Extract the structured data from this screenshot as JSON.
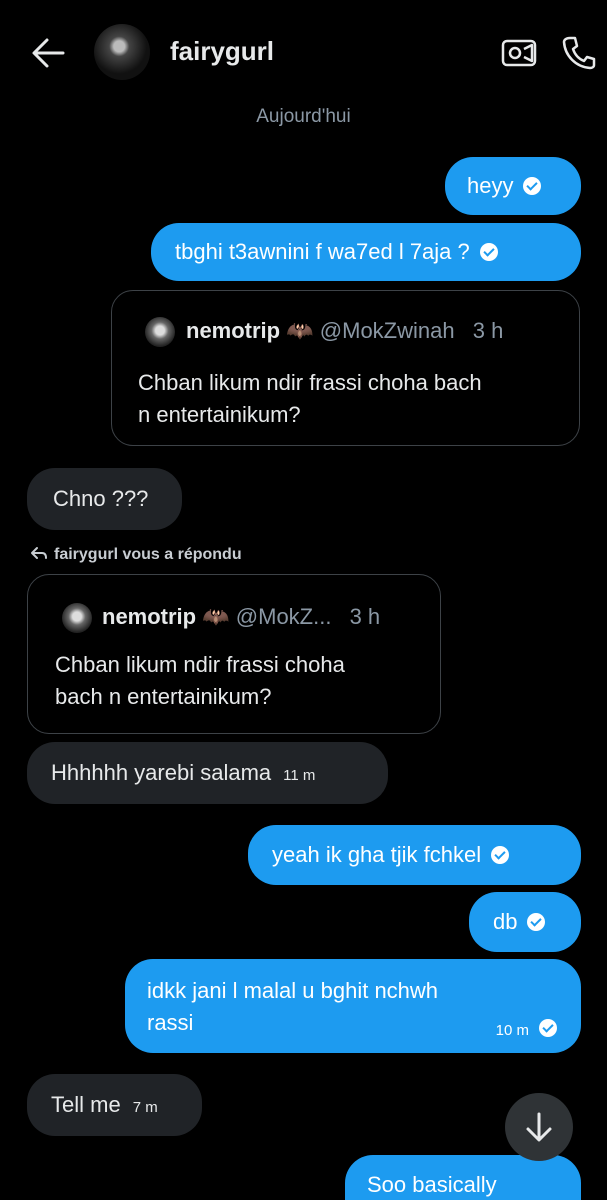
{
  "header": {
    "title": "fairygurl"
  },
  "day_label": "Aujourd'hui",
  "messages": {
    "m1": "heyy",
    "m2": "tbghi t3awnini f wa7ed l 7aja ?",
    "quote1": {
      "name": "nemotrip",
      "emoji": "🦇",
      "handle": "@MokZwinah",
      "time": "3 h",
      "line1": "Chban likum ndir frassi choha bach",
      "line2": "n entertainikum?"
    },
    "m3": "Chno ???",
    "replied_label": "fairygurl vous a répondu",
    "quote2": {
      "name": "nemotrip",
      "emoji": "🦇",
      "handle": "@MokZ...",
      "time": "3 h",
      "line1": "Chban likum ndir frassi choha",
      "line2": "bach n entertainikum?"
    },
    "m4": {
      "text": "Hhhhhh yarebi salama",
      "time": "11 m"
    },
    "m5": "yeah ik gha tjik fchkel",
    "m6": "db",
    "m7": {
      "line1": "idkk jani l malal u bghit nchwh",
      "line2": "rassi",
      "time": "10 m"
    },
    "m8": {
      "text": "Tell me",
      "time": "7 m"
    },
    "m9": "Soo basically"
  },
  "icons": {
    "back": "back-arrow-icon",
    "video": "video-call-icon",
    "phone": "phone-call-icon",
    "scroll": "arrow-down-icon",
    "reply": "reply-icon",
    "check": "sent-check-icon"
  },
  "colors": {
    "accent": "#1d9bf0",
    "incoming": "#202327",
    "background": "#000000",
    "muted": "#8b98a5"
  }
}
